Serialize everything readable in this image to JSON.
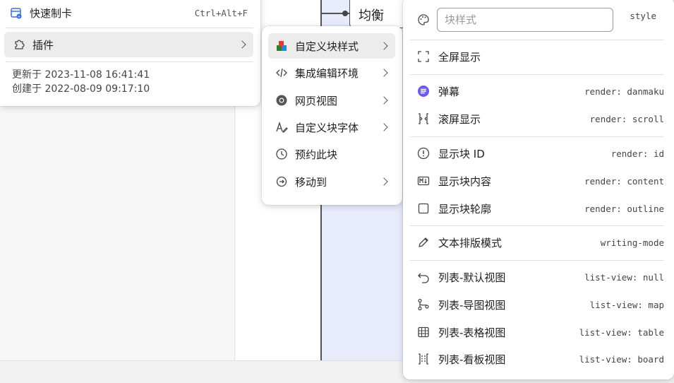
{
  "background": {
    "mindmap_node": "均衡"
  },
  "menu1": {
    "quick_card": {
      "label": "快速制卡",
      "shortcut": "Ctrl+Alt+F"
    },
    "plugins": {
      "label": "插件"
    },
    "updated": "更新于 2023-11-08 16:41:41",
    "created": "创建于 2022-08-09 09:17:10"
  },
  "menu2": {
    "items": [
      {
        "label": "自定义块样式",
        "icon": "colored-blocks-icon",
        "submenu": true
      },
      {
        "label": "集成编辑环境",
        "icon": "code-icon",
        "submenu": true
      },
      {
        "label": "网页视图",
        "icon": "chrome-icon",
        "submenu": true
      },
      {
        "label": "自定义块字体",
        "icon": "font-pen-icon",
        "submenu": true
      },
      {
        "label": "预约此块",
        "icon": "clock-icon",
        "submenu": false
      },
      {
        "label": "移动到",
        "icon": "move-icon",
        "submenu": true
      }
    ]
  },
  "menu3": {
    "search": {
      "placeholder": "块样式",
      "value": "",
      "hint": "style"
    },
    "items": [
      {
        "label": "全屏显示",
        "code": "",
        "icon": "fullscreen-icon"
      },
      {
        "label": "弹幕",
        "code": "render: danmaku",
        "icon": "danmaku-icon"
      },
      {
        "label": "滚屏显示",
        "code": "render: scroll",
        "icon": "scroll-icon"
      },
      {
        "label": "显示块 ID",
        "code": "render: id",
        "icon": "info-circle-icon"
      },
      {
        "label": "显示块内容",
        "code": "render: content",
        "icon": "markdown-icon"
      },
      {
        "label": "显示块轮廓",
        "code": "render: outline",
        "icon": "square-icon"
      },
      {
        "label": "文本排版模式",
        "code": "writing-mode",
        "icon": "pencil-icon"
      },
      {
        "label": "列表-默认视图",
        "code": "list-view: null",
        "icon": "undo-icon"
      },
      {
        "label": "列表-导图视图",
        "code": "list-view: map",
        "icon": "branch-icon"
      },
      {
        "label": "列表-表格视图",
        "code": "list-view: table",
        "icon": "table-icon"
      },
      {
        "label": "列表-看板视图",
        "code": "list-view: board",
        "icon": "board-icon"
      }
    ]
  },
  "colors": {
    "accent": "#6c5ce7",
    "highlight": "#ececec"
  }
}
